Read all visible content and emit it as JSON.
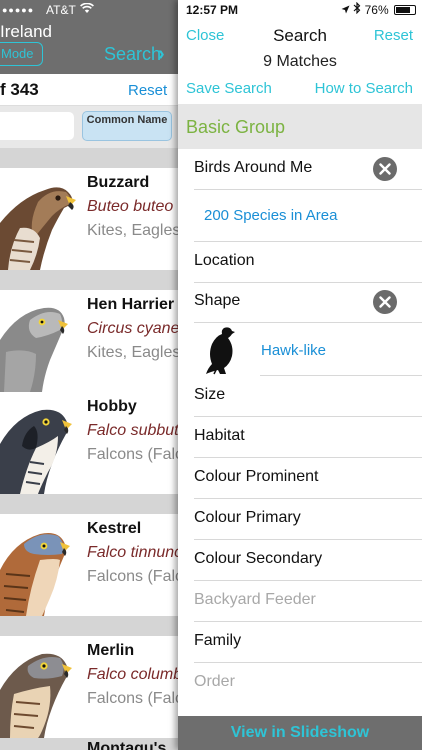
{
  "background": {
    "status": {
      "carrier": "AT&T"
    },
    "title": "Ireland",
    "mode_button": "Mode",
    "search_link": "Search",
    "count": "f 343",
    "reset": "Reset",
    "common_name_button": "Common Name",
    "birds": [
      {
        "name": "Buzzard",
        "latin": "Buteo buteo",
        "family": "Kites, Eagles"
      },
      {
        "name": "Hen Harrier",
        "latin": "Circus cyaneus",
        "family": "Kites, Eagles"
      },
      {
        "name": "Hobby",
        "latin": "Falco subbuteo",
        "family": "Falcons (Falconidae)"
      },
      {
        "name": "Kestrel",
        "latin": "Falco tinnunculus",
        "family": "Falcons (Falconidae)"
      },
      {
        "name": "Merlin",
        "latin": "Falco columbarius",
        "family": "Falcons (Falconidae)"
      },
      {
        "name": "Montagu's",
        "latin": "",
        "family": ""
      }
    ]
  },
  "panel": {
    "status": {
      "time": "12:57 PM",
      "battery": "76%"
    },
    "close": "Close",
    "title": "Search",
    "reset": "Reset",
    "matches": "9 Matches",
    "save_search": "Save Search",
    "how_to_search": "How to Search",
    "group_header": "Basic Group",
    "rows": {
      "birds_around_me": "Birds Around Me",
      "species_in_area": "200 Species in Area",
      "location": "Location",
      "shape": "Shape",
      "shape_value": "Hawk-like",
      "size": "Size",
      "habitat": "Habitat",
      "colour_prominent": "Colour Prominent",
      "colour_primary": "Colour Primary",
      "colour_secondary": "Colour Secondary",
      "backyard_feeder": "Backyard Feeder",
      "family": "Family",
      "order": "Order"
    },
    "footer": "View in Slideshow"
  },
  "colors": {
    "accent": "#2ec4d6",
    "group_header": "#7cb342",
    "link_blue": "#1a8fd6",
    "latin_name": "#7a2a2a"
  },
  "icons": [
    "wifi-icon",
    "chevron-right-icon",
    "location-arrow-icon",
    "bluetooth-icon",
    "battery-icon",
    "clear-icon",
    "hawk-silhouette-icon"
  ]
}
